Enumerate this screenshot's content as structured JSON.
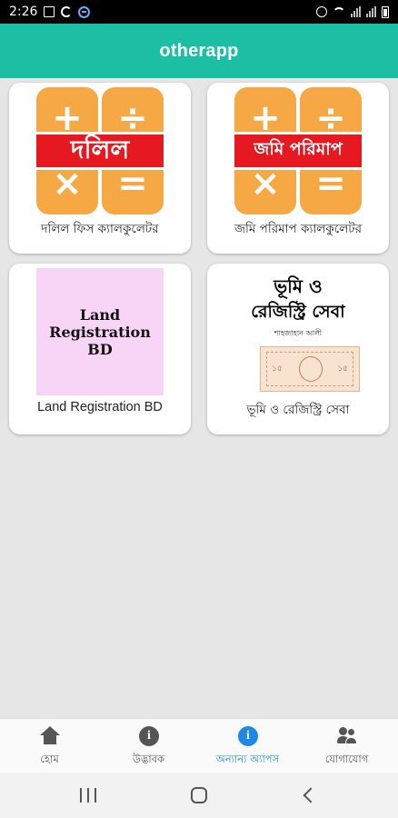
{
  "status_bar": {
    "time": "2:26",
    "left_icons": [
      "image-icon",
      "sync-icon",
      "messenger-icon"
    ],
    "right_icons": [
      "alarm-icon",
      "wifi-icon",
      "signal-icon",
      "signal-icon",
      "battery-icon"
    ]
  },
  "app_bar": {
    "title": "otherapp"
  },
  "apps": [
    {
      "label": "দলিল ফিস ক্যালকুলেটর",
      "banner": "দলিল",
      "icon": "calculator-icon"
    },
    {
      "label": "জমি পরিমাপ ক্যালকুলেটর",
      "banner": "জমি পরিমাপ",
      "icon": "calculator-icon"
    },
    {
      "label": "Land Registration BD",
      "tile_text": "Land\nRegistration\nBD"
    },
    {
      "label": "ভূমি ও রেজিস্ট্রি সেবা",
      "tile_line1": "ভূমি ও",
      "tile_line2": "রেজিস্ট্রি সেবা",
      "tile_author": "শাহজাহান আলী",
      "stamp_value": "১৫"
    }
  ],
  "calc_symbols": {
    "plus": "+",
    "divide": "÷",
    "times": "×",
    "equals": "="
  },
  "bottom_nav": {
    "active_index": 2,
    "active_color": "#1e88e5",
    "items": [
      {
        "label": "হোম",
        "icon": "home-icon"
      },
      {
        "label": "উদ্ভাবক",
        "icon": "info-icon"
      },
      {
        "label": "অন্যান্য অ্যাপস",
        "icon": "info-icon"
      },
      {
        "label": "যোগাযোগ",
        "icon": "people-icon"
      }
    ]
  },
  "colors": {
    "app_bar": "#1cbfa3",
    "calc_orange": "#f5a843",
    "calc_banner": "#e5191f",
    "land_tile": "#f8d4f6"
  }
}
